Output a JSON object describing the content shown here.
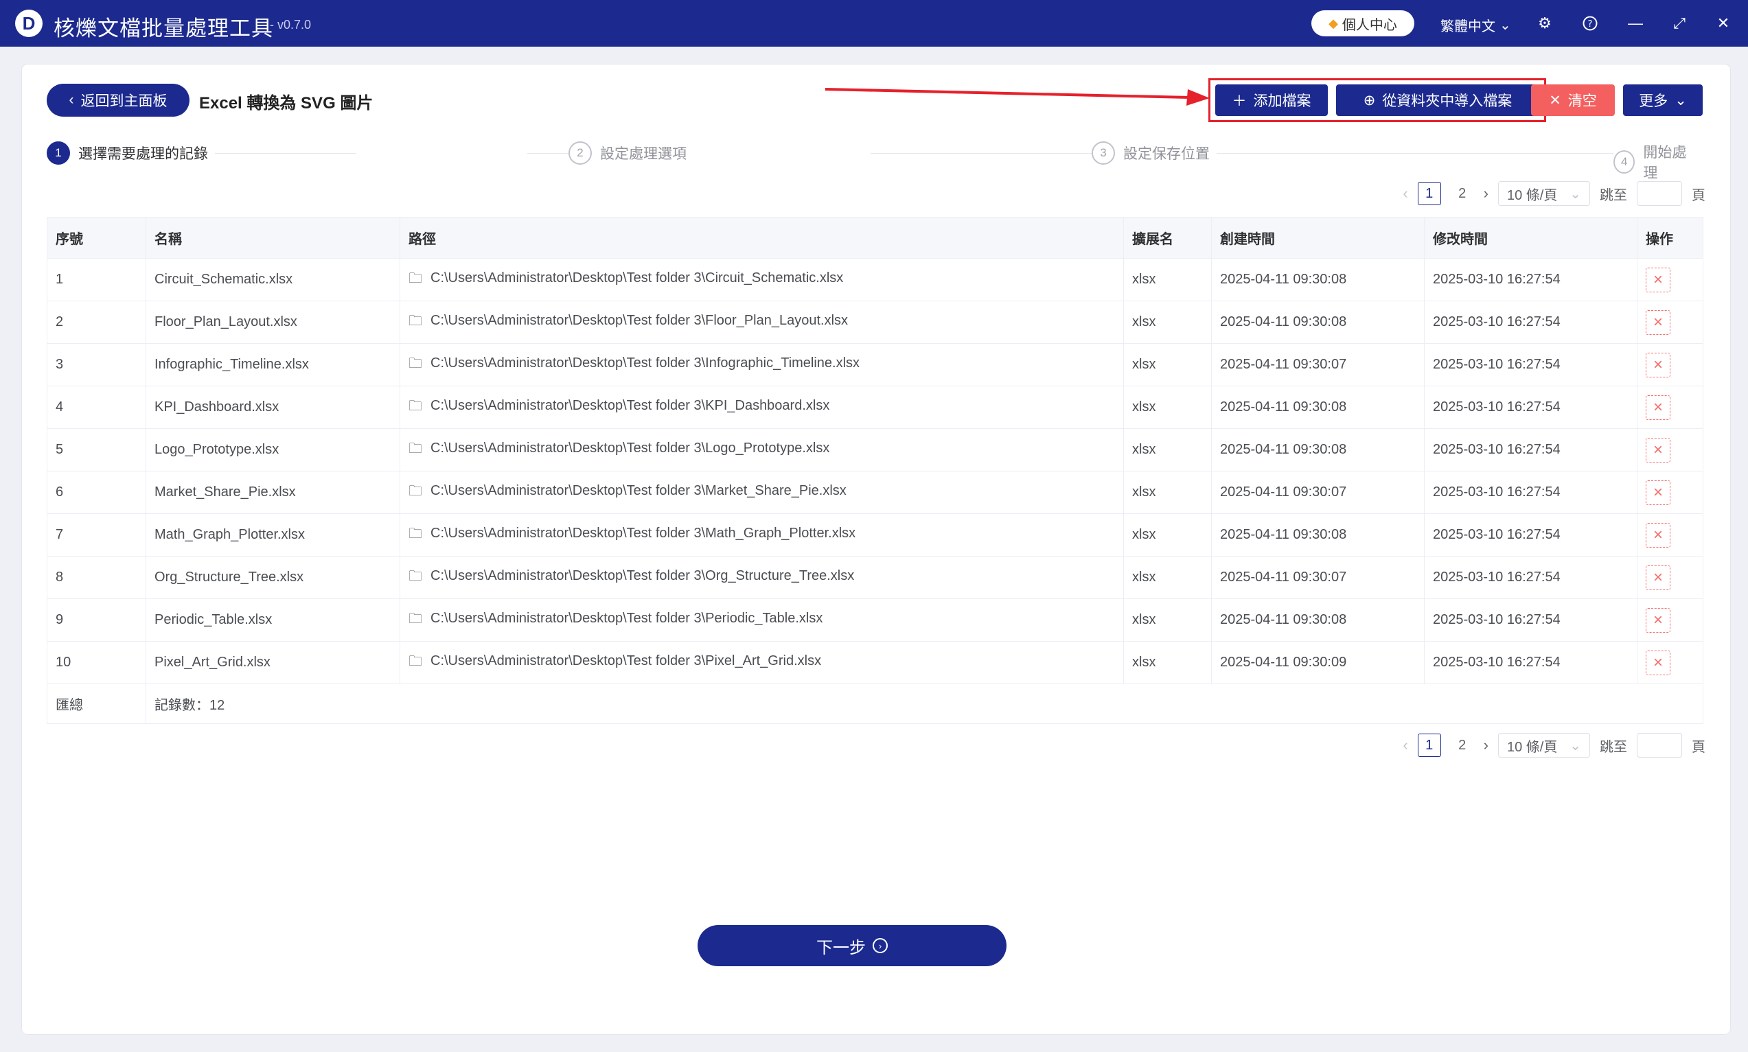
{
  "app": {
    "logo_letter": "D",
    "title": "核爍文檔批量處理工具",
    "version": "- v0.7.0",
    "personal_center": "個人中心",
    "language": "繁體中文"
  },
  "header": {
    "back_label": "返回到主面板",
    "page_title": "Excel 轉換為 SVG 圖片",
    "add_file": "添加檔案",
    "import_folder": "從資料夾中導入檔案",
    "clear": "清空",
    "more": "更多"
  },
  "steps": [
    {
      "num": "1",
      "label": "選擇需要處理的記錄"
    },
    {
      "num": "2",
      "label": "設定處理選項"
    },
    {
      "num": "3",
      "label": "設定保存位置"
    },
    {
      "num": "4",
      "label": "開始處理"
    }
  ],
  "pagination": {
    "pages": [
      "1",
      "2"
    ],
    "page_size": "10 條/頁",
    "jump_label": "跳至",
    "page_unit": "頁"
  },
  "table": {
    "columns": [
      "序號",
      "名稱",
      "路徑",
      "擴展名",
      "創建時間",
      "修改時間",
      "操作"
    ],
    "rows": [
      {
        "no": "1",
        "name": "Circuit_Schematic.xlsx",
        "path": "C:\\Users\\Administrator\\Desktop\\Test folder 3\\Circuit_Schematic.xlsx",
        "ext": "xlsx",
        "created": "2025-04-11 09:30:08",
        "modified": "2025-03-10 16:27:54"
      },
      {
        "no": "2",
        "name": "Floor_Plan_Layout.xlsx",
        "path": "C:\\Users\\Administrator\\Desktop\\Test folder 3\\Floor_Plan_Layout.xlsx",
        "ext": "xlsx",
        "created": "2025-04-11 09:30:08",
        "modified": "2025-03-10 16:27:54"
      },
      {
        "no": "3",
        "name": "Infographic_Timeline.xlsx",
        "path": "C:\\Users\\Administrator\\Desktop\\Test folder 3\\Infographic_Timeline.xlsx",
        "ext": "xlsx",
        "created": "2025-04-11 09:30:07",
        "modified": "2025-03-10 16:27:54"
      },
      {
        "no": "4",
        "name": "KPI_Dashboard.xlsx",
        "path": "C:\\Users\\Administrator\\Desktop\\Test folder 3\\KPI_Dashboard.xlsx",
        "ext": "xlsx",
        "created": "2025-04-11 09:30:08",
        "modified": "2025-03-10 16:27:54"
      },
      {
        "no": "5",
        "name": "Logo_Prototype.xlsx",
        "path": "C:\\Users\\Administrator\\Desktop\\Test folder 3\\Logo_Prototype.xlsx",
        "ext": "xlsx",
        "created": "2025-04-11 09:30:08",
        "modified": "2025-03-10 16:27:54"
      },
      {
        "no": "6",
        "name": "Market_Share_Pie.xlsx",
        "path": "C:\\Users\\Administrator\\Desktop\\Test folder 3\\Market_Share_Pie.xlsx",
        "ext": "xlsx",
        "created": "2025-04-11 09:30:07",
        "modified": "2025-03-10 16:27:54"
      },
      {
        "no": "7",
        "name": "Math_Graph_Plotter.xlsx",
        "path": "C:\\Users\\Administrator\\Desktop\\Test folder 3\\Math_Graph_Plotter.xlsx",
        "ext": "xlsx",
        "created": "2025-04-11 09:30:08",
        "modified": "2025-03-10 16:27:54"
      },
      {
        "no": "8",
        "name": "Org_Structure_Tree.xlsx",
        "path": "C:\\Users\\Administrator\\Desktop\\Test folder 3\\Org_Structure_Tree.xlsx",
        "ext": "xlsx",
        "created": "2025-04-11 09:30:07",
        "modified": "2025-03-10 16:27:54"
      },
      {
        "no": "9",
        "name": "Periodic_Table.xlsx",
        "path": "C:\\Users\\Administrator\\Desktop\\Test folder 3\\Periodic_Table.xlsx",
        "ext": "xlsx",
        "created": "2025-04-11 09:30:08",
        "modified": "2025-03-10 16:27:54"
      },
      {
        "no": "10",
        "name": "Pixel_Art_Grid.xlsx",
        "path": "C:\\Users\\Administrator\\Desktop\\Test folder 3\\Pixel_Art_Grid.xlsx",
        "ext": "xlsx",
        "created": "2025-04-11 09:30:09",
        "modified": "2025-03-10 16:27:54"
      }
    ],
    "summary_label": "匯總",
    "summary_value": "記錄數：12"
  },
  "footer": {
    "next_label": "下一步"
  },
  "colors": {
    "primary": "#1c2a8f",
    "danger": "#f45f5f",
    "highlight": "#e5212b"
  }
}
